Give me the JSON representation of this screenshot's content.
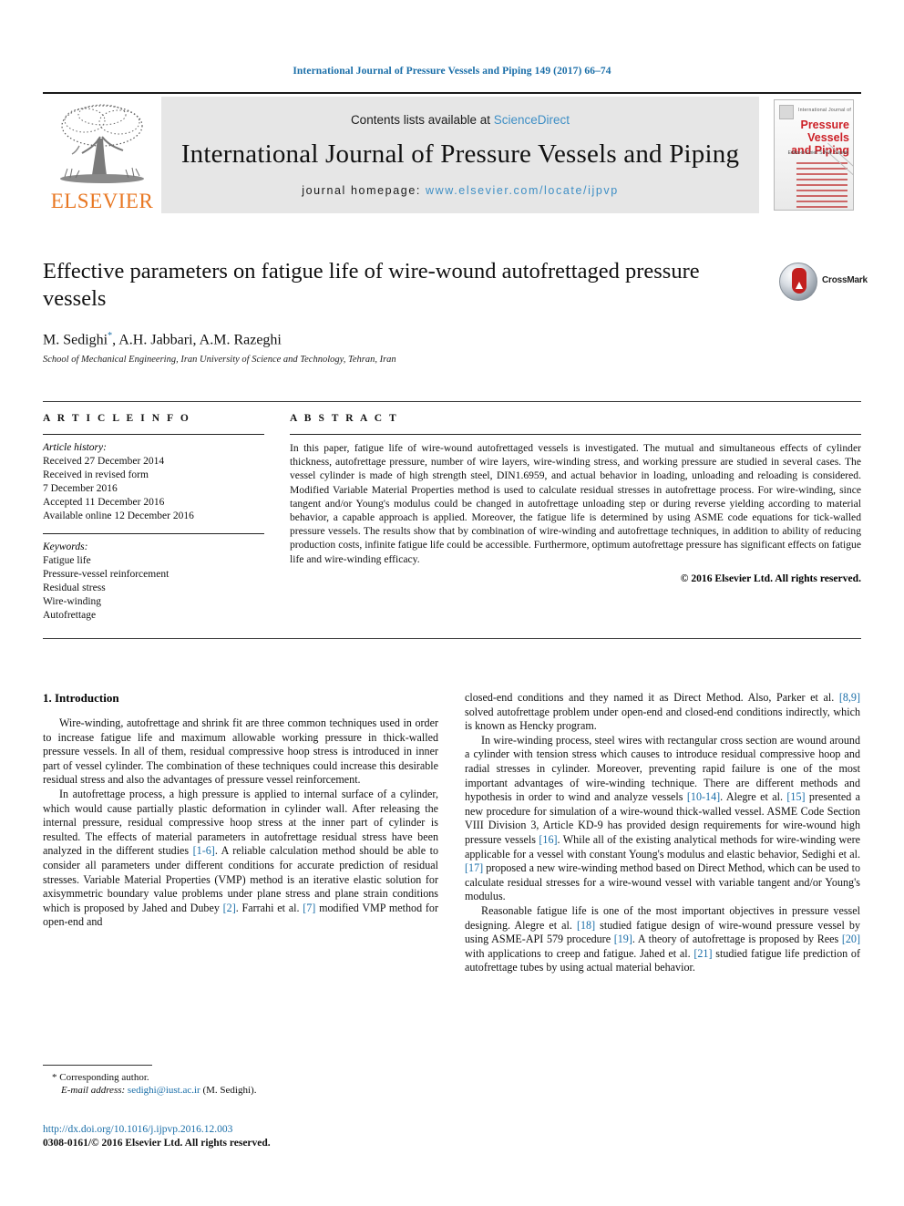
{
  "running_head": "International Journal of Pressure Vessels and Piping 149 (2017) 66–74",
  "masthead": {
    "publisher_name": "ELSEVIER",
    "contents_prefix": "Contents lists available at ",
    "sciencedirect": "ScienceDirect",
    "journal_title": "International Journal of Pressure Vessels and Piping",
    "homepage_prefix": "journal homepage: ",
    "homepage_url": "www.elsevier.com/locate/ijpvp",
    "cover": {
      "kicker": "International Journal of",
      "title_line1": "Pressure Vessels",
      "title_line2": "and Piping",
      "editor": "Editor-in-Chief: S.N.A. Suresh"
    }
  },
  "article": {
    "title": "Effective parameters on fatigue life of wire-wound autofrettaged pressure vessels",
    "authors": "M. Sedighi",
    "authors_rest": ", A.H. Jabbari, A.M. Razeghi",
    "corresponding_marker": "*",
    "affiliation": "School of Mechanical Engineering, Iran University of Science and Technology, Tehran, Iran"
  },
  "crossmark": {
    "label": "CrossMark"
  },
  "article_info": {
    "heading": "A R T I C L E   I N F O",
    "history_label": "Article history:",
    "history": [
      "Received 27 December 2014",
      "Received in revised form",
      "7 December 2016",
      "Accepted 11 December 2016",
      "Available online 12 December 2016"
    ],
    "keywords_label": "Keywords:",
    "keywords": [
      "Fatigue life",
      "Pressure-vessel reinforcement",
      "Residual stress",
      "Wire-winding",
      "Autofrettage"
    ]
  },
  "abstract": {
    "heading": "A B S T R A C T",
    "text": "In this paper, fatigue life of wire-wound autofrettaged vessels is investigated. The mutual and simultaneous effects of cylinder thickness, autofrettage pressure, number of wire layers, wire-winding stress, and working pressure are studied in several cases. The vessel cylinder is made of high strength steel, DIN1.6959, and actual behavior in loading, unloading and reloading is considered. Modified Variable Material Properties method is used to calculate residual stresses in autofrettage process. For wire-winding, since tangent and/or Young's modulus could be changed in autofrettage unloading step or during reverse yielding according to material behavior, a capable approach is applied. Moreover, the fatigue life is determined by using ASME code equations for tick-walled pressure vessels. The results show that by combination of wire-winding and autofrettage techniques, in addition to ability of reducing production costs, infinite fatigue life could be accessible. Furthermore, optimum autofrettage pressure has significant effects on fatigue life and wire-winding efficacy.",
    "copyright": "© 2016 Elsevier Ltd. All rights reserved."
  },
  "body": {
    "section_title": "1. Introduction",
    "left_paragraphs": [
      "Wire-winding, autofrettage and shrink fit are three common techniques used in order to increase fatigue life and maximum allowable working pressure in thick-walled pressure vessels. In all of them, residual compressive hoop stress is introduced in inner part of vessel cylinder. The combination of these techniques could increase this desirable residual stress and also the advantages of pressure vessel reinforcement."
    ],
    "left_para2_a": "In autofrettage process, a high pressure is applied to internal surface of a cylinder, which would cause partially plastic deformation in cylinder wall. After releasing the internal pressure, residual compressive hoop stress at the inner part of cylinder is resulted. The effects of material parameters in autofrettage residual stress have been analyzed in the different studies ",
    "left_para2_ref1": "[1-6]",
    "left_para2_b": ". A reliable calculation method should be able to consider all parameters under different conditions for accurate prediction of residual stresses. Variable Material Properties (VMP) method is an iterative elastic solution for axisymmetric boundary value problems under plane stress and plane strain conditions which is proposed by Jahed and Dubey ",
    "left_para2_ref2": "[2]",
    "left_para2_c": ". Farrahi et al. ",
    "left_para2_ref3": "[7]",
    "left_para2_d": " modified VMP method for open-end and",
    "right_para1_a": "closed-end conditions and they named it as Direct Method. Also, Parker et al. ",
    "right_para1_ref1": "[8,9]",
    "right_para1_b": " solved autofrettage problem under open-end and closed-end conditions indirectly, which is known as Hencky program.",
    "right_para2_a": "In wire-winding process, steel wires with rectangular cross section are wound around a cylinder with tension stress which causes to introduce residual compressive hoop and radial stresses in cylinder. Moreover, preventing rapid failure is one of the most important advantages of wire-winding technique. There are different methods and hypothesis in order to wind and analyze vessels ",
    "right_para2_ref1": "[10-14]",
    "right_para2_b": ". Alegre et al. ",
    "right_para2_ref2": "[15]",
    "right_para2_c": " presented a new procedure for simulation of a wire-wound thick-walled vessel. ASME Code Section VIII Division 3, Article KD-9 has provided design requirements for wire-wound high pressure vessels ",
    "right_para2_ref3": "[16]",
    "right_para2_d": ". While all of the existing analytical methods for wire-winding were applicable for a vessel with constant Young's modulus and elastic behavior, Sedighi et al. ",
    "right_para2_ref4": "[17]",
    "right_para2_e": " proposed a new wire-winding method based on Direct Method, which can be used to calculate residual stresses for a wire-wound vessel with variable tangent and/or Young's modulus.",
    "right_para3_a": "Reasonable fatigue life is one of the most important objectives in pressure vessel designing. Alegre et al. ",
    "right_para3_ref1": "[18]",
    "right_para3_b": " studied fatigue design of wire-wound pressure vessel by using ASME-API 579 procedure ",
    "right_para3_ref2": "[19]",
    "right_para3_c": ". A theory of autofrettage is proposed by Rees ",
    "right_para3_ref3": "[20]",
    "right_para3_d": " with applications to creep and fatigue. Jahed et al. ",
    "right_para3_ref4": "[21]",
    "right_para3_e": " studied fatigue life prediction of autofrettage tubes by using actual material behavior."
  },
  "footer": {
    "corresponding_star": "*",
    "corresponding_text": "Corresponding author.",
    "email_label": "E-mail address:",
    "email": "sedighi@iust.ac.ir",
    "email_suffix": " (M. Sedighi).",
    "doi": "http://dx.doi.org/10.1016/j.ijpvp.2016.12.003",
    "issn": "0308-0161/© 2016 Elsevier Ltd. All rights reserved."
  },
  "colors": {
    "link": "#1a6ea8",
    "sciencedirect": "#3f8fc5",
    "elsevier_orange": "#e87722",
    "cover_red": "#cc2027",
    "banner_bg": "#e6e6e6"
  }
}
